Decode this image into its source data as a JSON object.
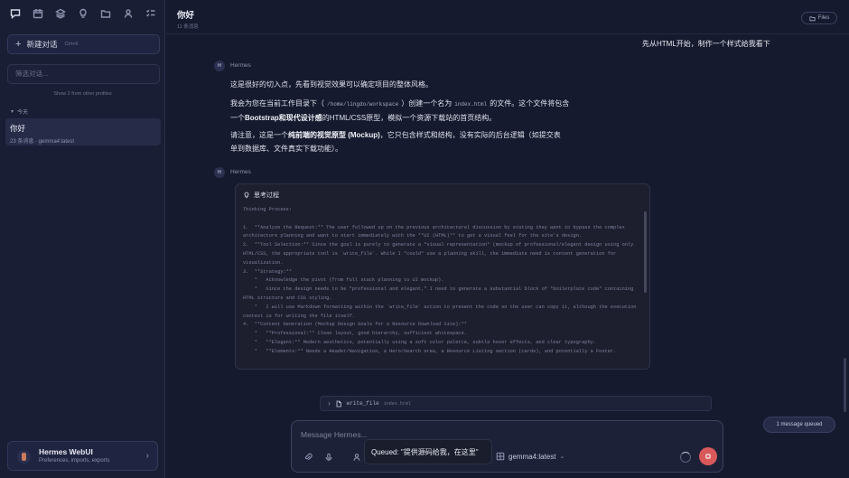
{
  "sidebar": {
    "icons": [
      "chat-icon",
      "calendar-icon",
      "layers-icon",
      "lightbulb-icon",
      "folder-icon",
      "user-icon",
      "checklist-icon"
    ],
    "new_chat_label": "新建对话",
    "new_chat_shortcut": "Ctrl+K",
    "filter_placeholder": "筛选对话...",
    "profiles_note": "Show 2 from other profiles",
    "group_label": "今天",
    "conversations": [
      {
        "title": "你好",
        "meta": "23 条消息 · gemma4:latest"
      }
    ],
    "brand": {
      "name": "Hermes WebUI",
      "subtitle": "Preferences, imports, exports"
    }
  },
  "header": {
    "title": "你好",
    "count": "11 条消息",
    "files_label": "Files"
  },
  "chat": {
    "user_message": "先从HTML开始，制作一个样式给我看下",
    "assistant_name": "Hermes",
    "assistant_avatar": "H",
    "para1": "这是很好的切入点，先看到视觉效果可以确定项目的整体风格。",
    "para2_a": "我会为您在当前工作目录下（",
    "para2_path": "/home/lingdo/workspace",
    "para2_b": "）创建一个名为",
    "para2_file": "index.html",
    "para2_c": "的文件。这个文件将包含",
    "para2_d": "一个",
    "para2_bold": "Bootstrap和现代设计感",
    "para2_e": "的HTML/CSS原型，模拟一个资源下载站的首页结构。",
    "para3_a": "请注意，这是一个",
    "para3_bold": "纯前端的视觉原型 (Mockup)",
    "para3_b": "，它只包含样式和结构，没有实际的后台逻辑（如提交表",
    "para3_c": "单到数据库、文件真实下载功能）。",
    "thinking_title": "思考过程",
    "thinking_text": "Thinking Process:\n\n1.  **Analyze the Request:** The user followed up on the previous architectural discussion by stating they want to bypass the complex architecture planning and want to start immediately with the **UI (HTML)** to get a visual feel for the site's design.\n2.  **Tool Selection:** Since the goal is purely to generate a *visual representation* (mockup of professional/elegant design using only HTML/CSS, the appropriate tool is `write_file`. While I *could* use a planning skill, the immediate need is content generation for visualization.\n3.  **Strategy:**\n    *   Acknowledge the pivot (from full stack planning to UI mockup).\n    *   Since the design needs to be \"professional and elegant,\" I need to generate a substantial block of *boilerplate code* containing HTML structure and CSS styling.\n    *   I will use Markdown formatting within the `write_file` action to present the code so the user can copy it, although the execution context is for writing the file itself.\n4.  **Content Generation (Mockup Design Goals for a Resource Download Site):**\n    *   **Professional:** Clean layout, good hierarchy, sufficient whitespace.\n    *   **Elegant:** Modern aesthetics, potentially using a soft color palette, subtle hover effects, and clear typography.\n    *   **Elements:** Needs a Header/Navigation, a Hero/Search area, a Resource Listing section (cards), and potentially a Footer.",
    "tool_name": "write_file",
    "tool_path": "index.html"
  },
  "queued_pill": "1 message queued",
  "composer": {
    "placeholder": "Message Hermes...",
    "model": "gemma4:latest",
    "queued_toast": "Queued: \"提供源码给我，在这里\""
  },
  "colors": {
    "background": "#161a2e",
    "sidebar": "#1a1e34",
    "send": "#d9595a"
  }
}
